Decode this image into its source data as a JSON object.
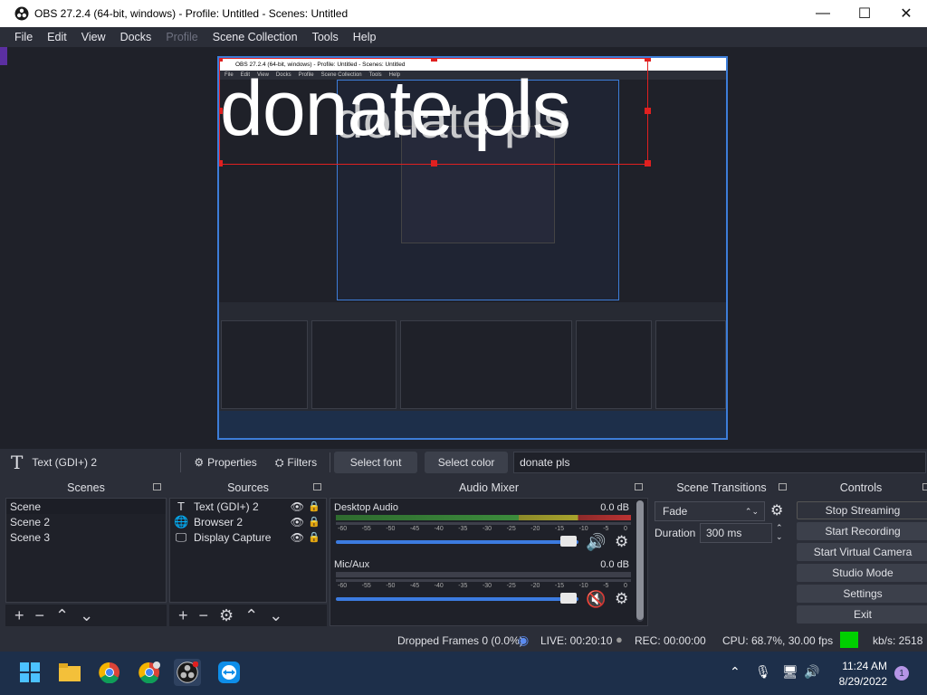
{
  "window": {
    "title": "OBS 27.2.4 (64-bit, windows) - Profile: Untitled - Scenes: Untitled",
    "minimize": "—",
    "maximize": "☐",
    "close": "✕"
  },
  "menu": [
    "File",
    "Edit",
    "View",
    "Docks",
    "Profile",
    "Scene Collection",
    "Tools",
    "Help"
  ],
  "preview": {
    "text_big": "donate pls",
    "text_mid": "donate pls",
    "mini_title": "OBS 27.2.4 (64-bit, windows) - Profile: Untitled - Scenes: Untitled"
  },
  "source_toolbar": {
    "source_name": "Text (GDI+) 2",
    "properties": "Properties",
    "filters": "Filters",
    "select_font": "Select font",
    "select_color": "Select color",
    "text_value": "donate pls"
  },
  "scenes": {
    "title": "Scenes",
    "items": [
      "Scene",
      "Scene 2",
      "Scene 3"
    ]
  },
  "sources": {
    "title": "Sources",
    "items": [
      {
        "name": "Text (GDI+) 2",
        "icon": "text-icon"
      },
      {
        "name": "Browser 2",
        "icon": "globe-icon"
      },
      {
        "name": "Display Capture",
        "icon": "monitor-icon"
      }
    ]
  },
  "mixer": {
    "title": "Audio Mixer",
    "channels": [
      {
        "name": "Desktop Audio",
        "db": "0.0 dB",
        "muted": false
      },
      {
        "name": "Mic/Aux",
        "db": "0.0 dB",
        "muted": true
      }
    ],
    "ticks": [
      "-60",
      "-55",
      "-50",
      "-45",
      "-40",
      "-35",
      "-30",
      "-25",
      "-20",
      "-15",
      "-10",
      "-5",
      "0"
    ]
  },
  "transitions": {
    "title": "Scene Transitions",
    "selected": "Fade",
    "duration_label": "Duration",
    "duration_value": "300 ms"
  },
  "controls": {
    "title": "Controls",
    "buttons": [
      "Stop Streaming",
      "Start Recording",
      "Start Virtual Camera",
      "Studio Mode",
      "Settings",
      "Exit"
    ]
  },
  "status": {
    "dropped": "Dropped Frames 0 (0.0%)",
    "live": "LIVE: 00:20:10",
    "rec": "REC: 00:00:00",
    "cpu": "CPU: 68.7%, 30.00 fps",
    "kbps": "kb/s: 2518",
    "status_color": "#00d000"
  },
  "taskbar": {
    "time": "11:24 AM",
    "date": "8/29/2022",
    "notifications": "1"
  }
}
